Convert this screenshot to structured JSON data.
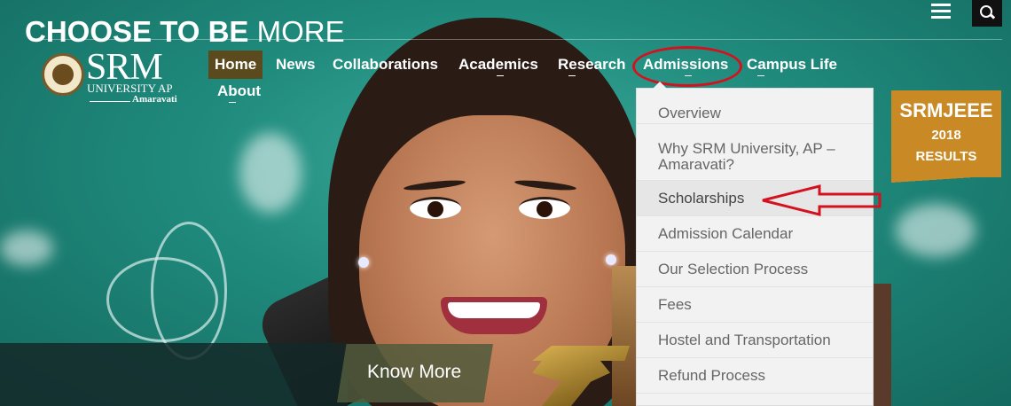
{
  "header": {
    "logo": {
      "name": "SRM",
      "subtitle": "UNIVERSITY AP",
      "city": "Amaravati"
    },
    "nav": [
      {
        "label": "Home",
        "active": true
      },
      {
        "label": "News"
      },
      {
        "label": "Collaborations"
      },
      {
        "label": "Academics"
      },
      {
        "label": "Research"
      },
      {
        "label": "Admissions",
        "highlighted": true
      },
      {
        "label": "Campus Life"
      },
      {
        "label": "About"
      }
    ],
    "menu_icon": "hamburger-icon",
    "search_icon": "search-icon"
  },
  "admissions_dropdown": {
    "items": [
      {
        "label": "Overview"
      },
      {
        "label": "Why SRM University, AP – Amaravati?"
      },
      {
        "label": "Scholarships",
        "active": true
      },
      {
        "label": "Admission Calendar"
      },
      {
        "label": "Our Selection Process"
      },
      {
        "label": "Fees"
      },
      {
        "label": "Hostel and Transportation"
      },
      {
        "label": "Refund Process"
      }
    ]
  },
  "badge": {
    "title": "SRMJEEE",
    "year": "2018",
    "subtitle": "RESULTS"
  },
  "banner": {
    "bold_text": "CHOOSE TO BE",
    "thin_text": "MORE",
    "cta_label": "Know More"
  },
  "colors": {
    "accent_gold": "#c98a25",
    "home_active": "#5b4a1e",
    "annotation_red": "#d4121f",
    "hero_teal": "#1f8a7c"
  }
}
